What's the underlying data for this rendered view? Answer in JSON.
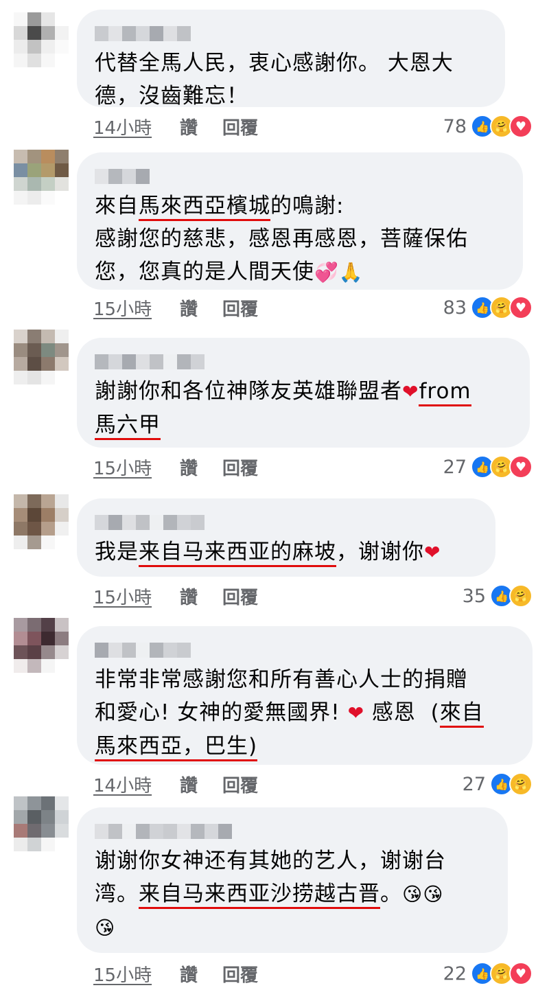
{
  "labels": {
    "like": "讚",
    "reply": "回覆"
  },
  "colors": {
    "highlight": "#e00b0b",
    "bubble": "#f0f2f5",
    "meta": "#65676b"
  },
  "comments": [
    {
      "lines": [
        [
          {
            "t": "代替全馬人民，衷心感謝你。 大恩大"
          }
        ],
        [
          {
            "t": "德，沒齒難忘！"
          }
        ]
      ],
      "time": "14小時",
      "count": "78",
      "reactions": [
        "like",
        "care",
        "love"
      ]
    },
    {
      "lines": [
        [
          {
            "t": "來自"
          },
          {
            "t": "馬來西亞檳城",
            "hl": true
          },
          {
            "t": "的鳴謝:"
          }
        ],
        [
          {
            "t": "感謝您的慈悲，感恩再感恩，菩薩保佑"
          }
        ],
        [
          {
            "t": "您，您真的是人間天使"
          },
          {
            "t": "💞🙏",
            "emoji": true
          }
        ]
      ],
      "time": "15小時",
      "count": "83",
      "reactions": [
        "like",
        "care",
        "love"
      ]
    },
    {
      "lines": [
        [
          {
            "t": "謝謝你和各位神隊友英雄聯盟者"
          },
          {
            "t": "❤",
            "emoji": true,
            "red": true
          },
          {
            "t": "from",
            "hl": true
          }
        ],
        [
          {
            "t": "馬六甲",
            "hl": true
          }
        ]
      ],
      "time": "15小時",
      "count": "27",
      "reactions": [
        "like",
        "care",
        "love"
      ]
    },
    {
      "lines": [
        [
          {
            "t": "我是"
          },
          {
            "t": "来自马来西亚的麻坡",
            "hl": true
          },
          {
            "t": "，谢谢你"
          },
          {
            "t": "❤",
            "emoji": true,
            "red": true
          }
        ]
      ],
      "time": "15小時",
      "count": "35",
      "reactions": [
        "like",
        "care"
      ]
    },
    {
      "lines": [
        [
          {
            "t": "非常非常感謝您和所有善心人士的捐贈"
          }
        ],
        [
          {
            "t": "和愛心! 女神的愛無國界! "
          },
          {
            "t": "❤",
            "emoji": true,
            "red": true
          },
          {
            "t": " 感恩  ("
          },
          {
            "t": "來自",
            "hl": true
          }
        ],
        [
          {
            "t": "馬來西亞，巴生)",
            "hl": true
          }
        ]
      ],
      "time": "14小時",
      "count": "27",
      "reactions": [
        "like",
        "care"
      ]
    },
    {
      "lines": [
        [
          {
            "t": "谢谢你女神还有其她的艺人，谢谢台"
          }
        ],
        [
          {
            "t": "湾。"
          },
          {
            "t": "来自马来西亚沙捞越古晋",
            "hl": true
          },
          {
            "t": "。"
          },
          {
            "t": "😘😘",
            "emoji": true
          }
        ],
        [
          {
            "t": "😘",
            "emoji": true
          }
        ]
      ],
      "time": "15小時",
      "count": "22",
      "reactions": [
        "like",
        "care",
        "love"
      ]
    }
  ]
}
